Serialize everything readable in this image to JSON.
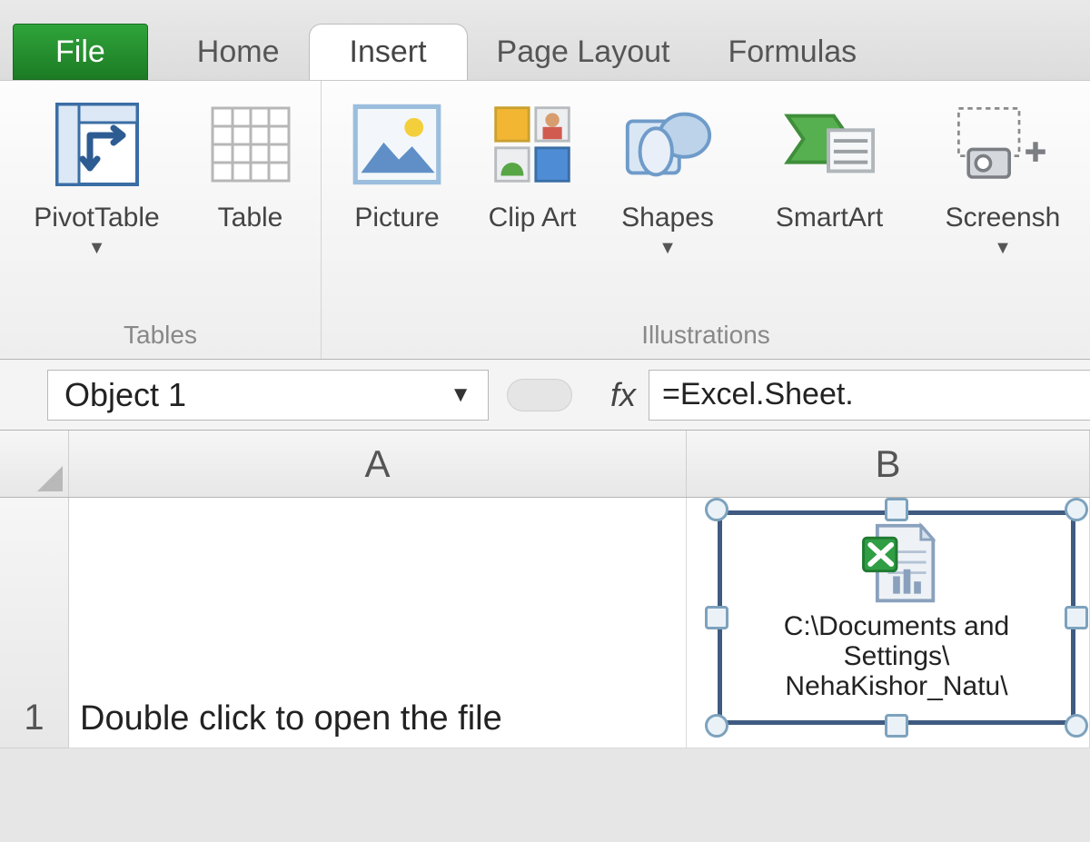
{
  "tabs": {
    "file": "File",
    "home": "Home",
    "insert": "Insert",
    "pagelayout": "Page Layout",
    "formulas": "Formulas",
    "active": "Insert"
  },
  "ribbon": {
    "groups": {
      "tables": {
        "label": "Tables",
        "pivot": "PivotTable",
        "table": "Table"
      },
      "illustrations": {
        "label": "Illustrations",
        "picture": "Picture",
        "clipart": "Clip Art",
        "shapes": "Shapes",
        "smartart": "SmartArt",
        "screenshot": "Screensh"
      }
    }
  },
  "formula_bar": {
    "name_box": "Object 1",
    "fx_label": "fx",
    "formula": "=Excel.Sheet."
  },
  "sheet": {
    "columns": [
      "A",
      "B"
    ],
    "rows": [
      {
        "num": "1",
        "A": "Double click to open the file",
        "B": ""
      }
    ]
  },
  "embedded_object": {
    "line1": "C:\\Documents and",
    "line2": "Settings\\",
    "line3": "NehaKishor_Natu\\"
  }
}
